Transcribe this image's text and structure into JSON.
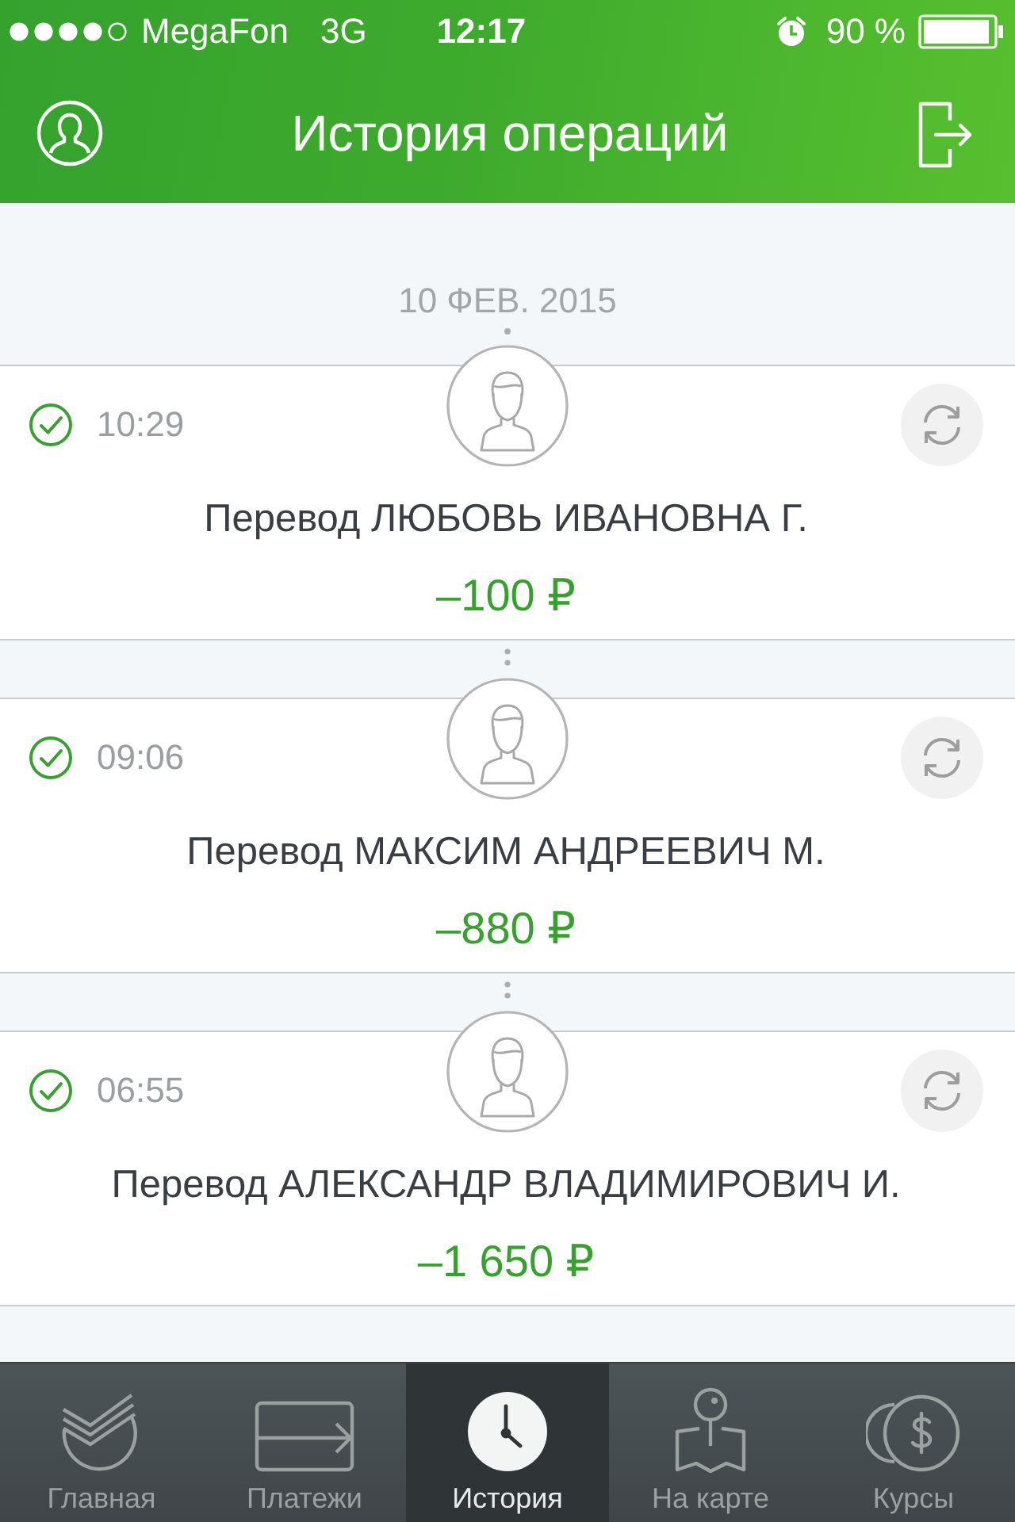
{
  "status_bar": {
    "carrier": "MegaFon",
    "network": "3G",
    "time": "12:17",
    "battery": "90 %"
  },
  "header": {
    "title": "История операций"
  },
  "date": "10 ФЕВ. 2015",
  "transactions": [
    {
      "time": "10:29",
      "description": "Перевод ЛЮБОВЬ ИВАНОВНА Г.",
      "amount": "–100 ₽"
    },
    {
      "time": "09:06",
      "description": "Перевод МАКСИМ АНДРЕЕВИЧ М.",
      "amount": "–880 ₽"
    },
    {
      "time": "06:55",
      "description": "Перевод АЛЕКСАНДР ВЛАДИМИРОВИЧ И.",
      "amount": "–1 650 ₽"
    }
  ],
  "tab_bar": {
    "tabs": [
      {
        "label": "Главная",
        "selected": false
      },
      {
        "label": "Платежи",
        "selected": false
      },
      {
        "label": "История",
        "selected": true
      },
      {
        "label": "На карте",
        "selected": false
      },
      {
        "label": "Курсы",
        "selected": false
      }
    ]
  }
}
